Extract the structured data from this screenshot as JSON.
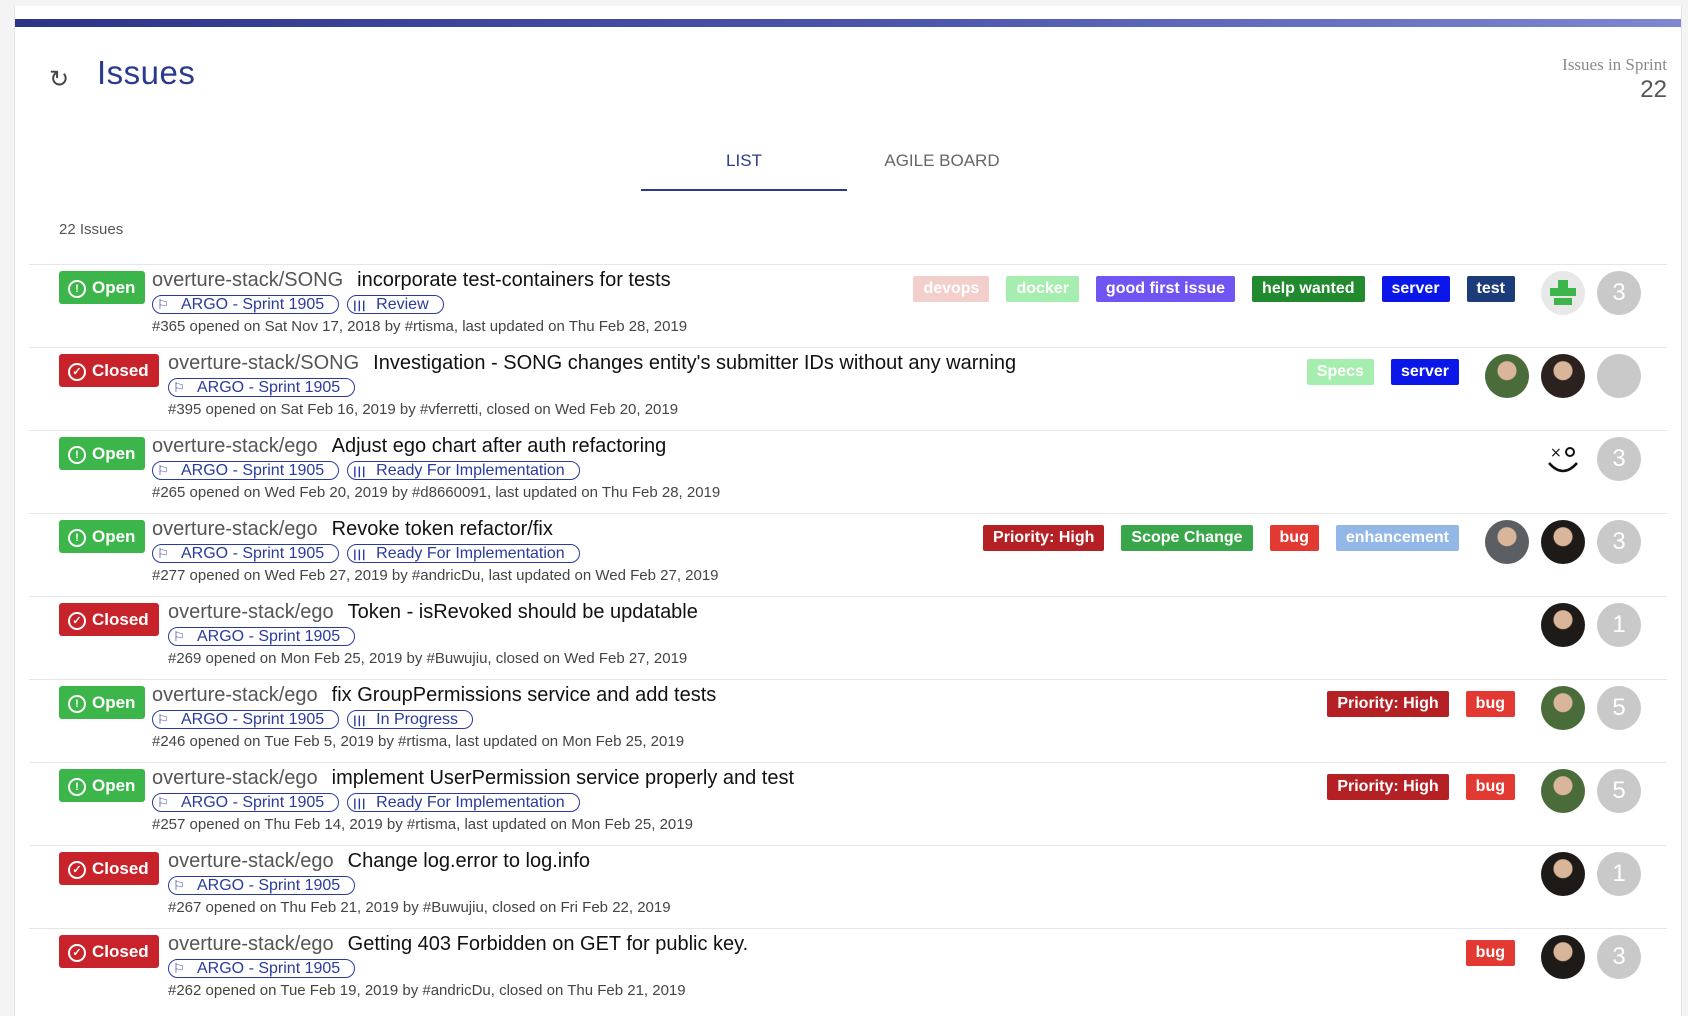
{
  "header": {
    "title": "Issues",
    "sprint_label": "Issues in Sprint",
    "sprint_count": "22",
    "refresh_icon": "refresh-icon"
  },
  "tabs": [
    {
      "label": "LIST",
      "active": true
    },
    {
      "label": "AGILE BOARD",
      "active": false
    }
  ],
  "issue_count": "22 Issues",
  "colors": {
    "accent": "#2a3a8e",
    "open": "#3cb54a",
    "closed": "#c8232b"
  },
  "issues": [
    {
      "status": "Open",
      "repo": "overture-stack/SONG",
      "title": "incorporate test-containers for tests",
      "chips": [
        {
          "icon": "runner-icon",
          "label": "ARGO - Sprint 1905"
        },
        {
          "icon": "columns-icon",
          "label": "Review"
        }
      ],
      "meta": "#365 opened on Sat Nov 17, 2018 by #rtisma, last updated on Thu Feb 28, 2019",
      "labels": [
        {
          "name": "devops",
          "color": "#f3cfcb"
        },
        {
          "name": "docker",
          "color": "#a6eeb0"
        },
        {
          "name": "good first issue",
          "color": "#7055f2"
        },
        {
          "name": "help wanted",
          "color": "#218a2f"
        },
        {
          "name": "server",
          "color": "#0a17e8"
        },
        {
          "name": "test",
          "color": "#1c3c79"
        }
      ],
      "avatars": [
        {
          "kind": "pixel",
          "color": "#3cb54a"
        }
      ],
      "comments": "3"
    },
    {
      "status": "Closed",
      "repo": "overture-stack/SONG",
      "title": "Investigation - SONG changes entity's submitter IDs without any warning",
      "chips": [
        {
          "icon": "runner-icon",
          "label": "ARGO - Sprint 1905"
        }
      ],
      "meta": "#395 opened on Sat Feb 16, 2019 by #vferretti, closed on Wed Feb 20, 2019",
      "labels": [
        {
          "name": "Specs",
          "color": "#a6eeb0"
        },
        {
          "name": "server",
          "color": "#0a17e8"
        }
      ],
      "avatars": [
        {
          "kind": "photo",
          "color": "#4a6b3a"
        },
        {
          "kind": "photo",
          "color": "#2b2220"
        }
      ],
      "comments": ""
    },
    {
      "status": "Open",
      "repo": "overture-stack/ego",
      "title": "Adjust ego chart after auth refactoring",
      "chips": [
        {
          "icon": "runner-icon",
          "label": "ARGO - Sprint 1905"
        },
        {
          "icon": "columns-icon",
          "label": "Ready For Implementation"
        }
      ],
      "meta": "#265 opened on Wed Feb 20, 2019 by #d8660091, last updated on Thu Feb 28, 2019",
      "labels": [],
      "avatars": [
        {
          "kind": "face",
          "color": "#ffffff"
        }
      ],
      "comments": "3"
    },
    {
      "status": "Open",
      "repo": "overture-stack/ego",
      "title": "Revoke token refactor/fix",
      "chips": [
        {
          "icon": "runner-icon",
          "label": "ARGO - Sprint 1905"
        },
        {
          "icon": "columns-icon",
          "label": "Ready For Implementation"
        }
      ],
      "meta": "#277 opened on Wed Feb 27, 2019 by #andricDu, last updated on Wed Feb 27, 2019",
      "labels": [
        {
          "name": "Priority: High",
          "color": "#b52025"
        },
        {
          "name": "Scope Change",
          "color": "#3aa64a"
        },
        {
          "name": "bug",
          "color": "#e23a33"
        },
        {
          "name": "enhancement",
          "color": "#93b8e8"
        }
      ],
      "avatars": [
        {
          "kind": "photo",
          "color": "#5b5e62"
        },
        {
          "kind": "photo",
          "color": "#1e1a18"
        }
      ],
      "comments": "3"
    },
    {
      "status": "Closed",
      "repo": "overture-stack/ego",
      "title": "Token - isRevoked should be updatable",
      "chips": [
        {
          "icon": "runner-icon",
          "label": "ARGO - Sprint 1905"
        }
      ],
      "meta": "#269 opened on Mon Feb 25, 2019 by #Buwujiu, closed on Wed Feb 27, 2019",
      "labels": [],
      "avatars": [
        {
          "kind": "photo",
          "color": "#1e1a18"
        }
      ],
      "comments": "1"
    },
    {
      "status": "Open",
      "repo": "overture-stack/ego",
      "title": "fix GroupPermissions service and add tests",
      "chips": [
        {
          "icon": "runner-icon",
          "label": "ARGO - Sprint 1905"
        },
        {
          "icon": "columns-icon",
          "label": "In Progress"
        }
      ],
      "meta": "#246 opened on Tue Feb 5, 2019 by #rtisma, last updated on Mon Feb 25, 2019",
      "labels": [
        {
          "name": "Priority: High",
          "color": "#b52025"
        },
        {
          "name": "bug",
          "color": "#e23a33"
        }
      ],
      "avatars": [
        {
          "kind": "photo",
          "color": "#4a6b3a"
        }
      ],
      "comments": "5"
    },
    {
      "status": "Open",
      "repo": "overture-stack/ego",
      "title": "implement UserPermission service properly and test",
      "chips": [
        {
          "icon": "runner-icon",
          "label": "ARGO - Sprint 1905"
        },
        {
          "icon": "columns-icon",
          "label": "Ready For Implementation"
        }
      ],
      "meta": "#257 opened on Thu Feb 14, 2019 by #rtisma, last updated on Mon Feb 25, 2019",
      "labels": [
        {
          "name": "Priority: High",
          "color": "#b52025"
        },
        {
          "name": "bug",
          "color": "#e23a33"
        }
      ],
      "avatars": [
        {
          "kind": "photo",
          "color": "#4a6b3a"
        }
      ],
      "comments": "5"
    },
    {
      "status": "Closed",
      "repo": "overture-stack/ego",
      "title": "Change log.error to log.info",
      "chips": [
        {
          "icon": "runner-icon",
          "label": "ARGO - Sprint 1905"
        }
      ],
      "meta": "#267 opened on Thu Feb 21, 2019 by #Buwujiu, closed on Fri Feb 22, 2019",
      "labels": [],
      "avatars": [
        {
          "kind": "photo",
          "color": "#1e1a18"
        }
      ],
      "comments": "1"
    },
    {
      "status": "Closed",
      "repo": "overture-stack/ego",
      "title": "Getting 403 Forbidden on GET for public key.",
      "chips": [
        {
          "icon": "runner-icon",
          "label": "ARGO - Sprint 1905"
        }
      ],
      "meta": "#262 opened on Tue Feb 19, 2019 by #andricDu, closed on Thu Feb 21, 2019",
      "labels": [
        {
          "name": "bug",
          "color": "#e23a33"
        }
      ],
      "avatars": [
        {
          "kind": "photo",
          "color": "#1e1a18"
        }
      ],
      "comments": "3"
    }
  ]
}
